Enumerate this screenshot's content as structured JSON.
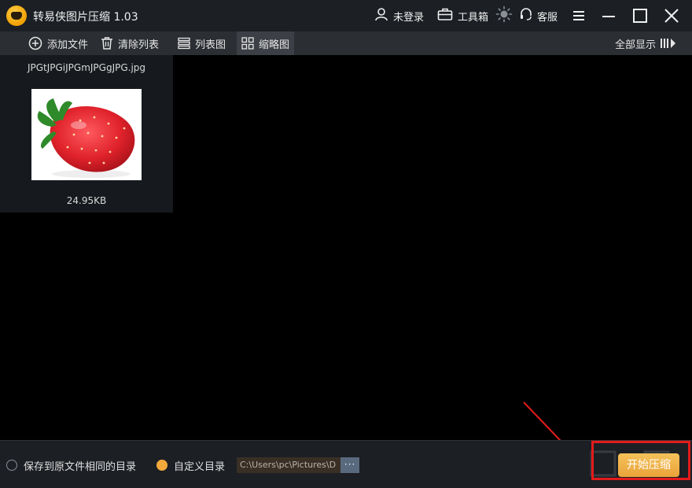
{
  "app": {
    "title": "转易侠图片压缩 1.03"
  },
  "titlebar": {
    "login_label": "未登录",
    "toolbox_label": "工具箱",
    "service_label": "客服"
  },
  "toolbar": {
    "add_file": "添加文件",
    "clear_list": "清除列表",
    "list_view": "列表图",
    "thumb_view": "缩略图",
    "show_all": "全部显示"
  },
  "files": [
    {
      "name": "JPGtJPGiJPGmJPGgJPG.jpg",
      "size": "24.95KB"
    }
  ],
  "bottom": {
    "option_same_dir": "保存到原文件相同的目录",
    "option_custom_dir": "自定义目录",
    "custom_path": "C:\\Users\\pc\\Pictures\\D",
    "browse_label": "···",
    "start_button": "开始压缩"
  },
  "colors": {
    "accent": "#f2a93b",
    "highlight": "#e21b1b",
    "titlebar_bg": "#1c1f24",
    "toolbar_bg": "#2b2e33"
  }
}
